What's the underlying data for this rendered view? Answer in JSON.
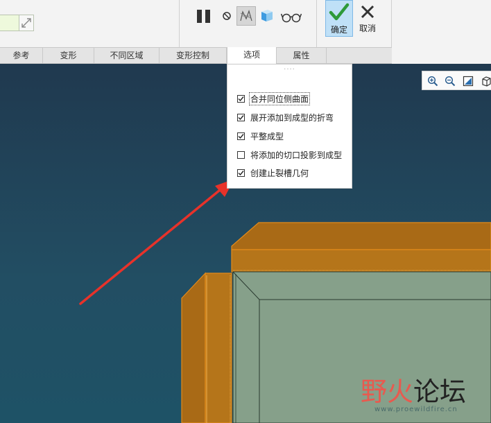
{
  "ribbon": {
    "ok_label": "确定",
    "cancel_label": "取消"
  },
  "tabs": [
    {
      "label": "参考"
    },
    {
      "label": "变形"
    },
    {
      "label": "不同区域"
    },
    {
      "label": "变形控制"
    },
    {
      "label": "选项",
      "active": true
    },
    {
      "label": "属性"
    }
  ],
  "options_panel": {
    "grip": "····",
    "items": [
      {
        "label": "合并同位侧曲面",
        "checked": true,
        "focused": true
      },
      {
        "label": "展开添加到成型的折弯",
        "checked": true
      },
      {
        "label": "平整成型",
        "checked": true
      },
      {
        "label": "将添加的切口投影到成型",
        "checked": false
      },
      {
        "label": "创建止裂槽几何",
        "checked": true
      }
    ]
  },
  "view_toolbar": {
    "icons": [
      "zoom-in-icon",
      "zoom-out-icon",
      "refit-icon",
      "saved-views-icon"
    ]
  },
  "watermark": {
    "text_a": "野火",
    "text_b": "论坛",
    "url": "www.proewildfire.cn"
  },
  "colors": {
    "accent_ok": "#bfe0f7",
    "part_orange": "#e38a1a",
    "part_face": "#86a08a",
    "arrow": "#e8322a",
    "viewport_top": "#20394f",
    "viewport_bottom": "#1e5266"
  }
}
